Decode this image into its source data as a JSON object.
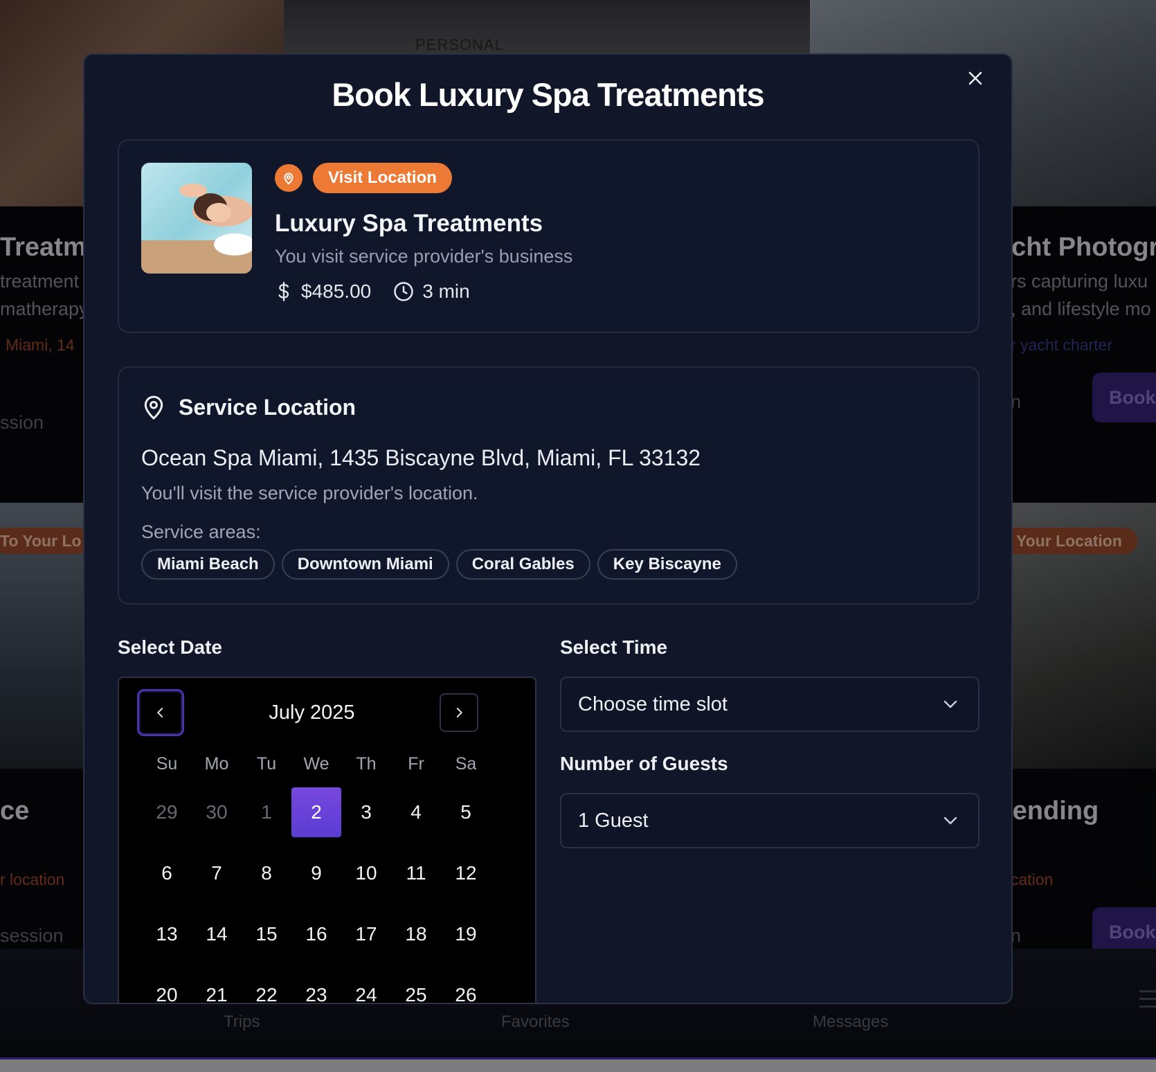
{
  "background": {
    "cards": [
      {
        "title": "Treatme",
        "desc1": "treatment",
        "desc2": "matherapy",
        "link": "Miami, 14",
        "footer": "ssion"
      },
      {
        "title": "acht Photogr",
        "desc1": "rs capturing luxu",
        "desc2": ", and lifestyle mo",
        "link": "r yacht charter",
        "footer": "n",
        "book": "Book"
      },
      {
        "title": "ce",
        "pill": "To Your Lo",
        "link": "r location",
        "footer": "session"
      },
      {
        "title": "tending",
        "pill": "Your Location",
        "link": "cation",
        "footer": "n",
        "book": "Book"
      }
    ],
    "photo_text": "PERSONAL",
    "nav": [
      "Trips",
      "Favorites",
      "Messages"
    ]
  },
  "modal": {
    "title": "Book Luxury Spa Treatments",
    "close_icon": "close-icon",
    "service": {
      "badge_icon": "map-pin-icon",
      "badge_label": "Visit Location",
      "name": "Luxury Spa Treatments",
      "subtitle": "You visit service provider's business",
      "price": "$485.00",
      "price_icon": "dollar-icon",
      "duration": "3 min",
      "duration_icon": "clock-icon"
    },
    "location": {
      "heading": "Service Location",
      "heading_icon": "map-pin-icon",
      "address": "Ocean Spa Miami, 1435 Biscayne Blvd, Miami, FL 33132",
      "note": "You'll visit the service provider's location.",
      "areas_label": "Service areas:",
      "areas": [
        "Miami Beach",
        "Downtown Miami",
        "Coral Gables",
        "Key Biscayne"
      ]
    },
    "date": {
      "label": "Select Date",
      "month": "July 2025",
      "weekdays": [
        "Su",
        "Mo",
        "Tu",
        "We",
        "Th",
        "Fr",
        "Sa"
      ],
      "weeks": [
        [
          "29",
          "30",
          "1",
          "2",
          "3",
          "4",
          "5"
        ],
        [
          "6",
          "7",
          "8",
          "9",
          "10",
          "11",
          "12"
        ],
        [
          "13",
          "14",
          "15",
          "16",
          "17",
          "18",
          "19"
        ],
        [
          "20",
          "21",
          "22",
          "23",
          "24",
          "25",
          "26"
        ]
      ],
      "muted_days": [
        "29",
        "30",
        "1"
      ],
      "selected_day": "2"
    },
    "time": {
      "label": "Select Time",
      "value": "Choose time slot"
    },
    "guests": {
      "label": "Number of Guests",
      "value": "1 Guest"
    }
  },
  "colors": {
    "accent_orange": "#ec7a34",
    "accent_purple": "#6a44dc",
    "modal_bg": "#111728"
  }
}
